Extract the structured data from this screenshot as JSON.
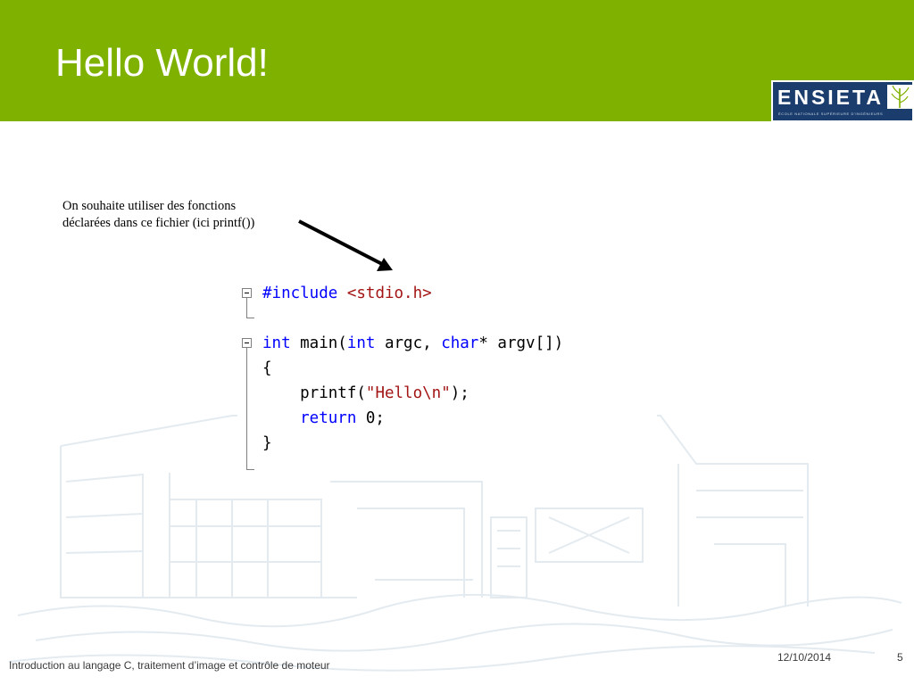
{
  "slide": {
    "title": "Hello World!",
    "colors": {
      "header": "#7fb100",
      "logo_panel": "#1b3d6d",
      "keyword": "#0000ff",
      "string": "#a31515"
    }
  },
  "logo": {
    "wordmark": "ENSIETA",
    "tagline": "ÉCOLE NATIONALE SUPÉRIEURE D'INGÉNIEURS",
    "icon": "plant-icon"
  },
  "annotation": {
    "line1": "On souhaite utiliser des fonctions",
    "line2": "déclarées dans ce fichier (ici printf())"
  },
  "code": {
    "line1_directive": "#include",
    "line1_header": "<stdio.h>",
    "line3_type": "int",
    "line3_name": " main(",
    "line3_type2": "int",
    "line3_arg1": " argc, ",
    "line3_type3": "char",
    "line3_arg2": "* argv[])",
    "line4": "{",
    "line5_fn": "    printf(",
    "line5_str": "\"Hello\\n\"",
    "line5_end": ");",
    "line6_kw": "    return",
    "line6_rest": " 0;",
    "line7": "}"
  },
  "footer": {
    "course": "Introduction au langage C, traitement d’image et contrôle de moteur",
    "date": "12/10/2014",
    "page": "5"
  }
}
